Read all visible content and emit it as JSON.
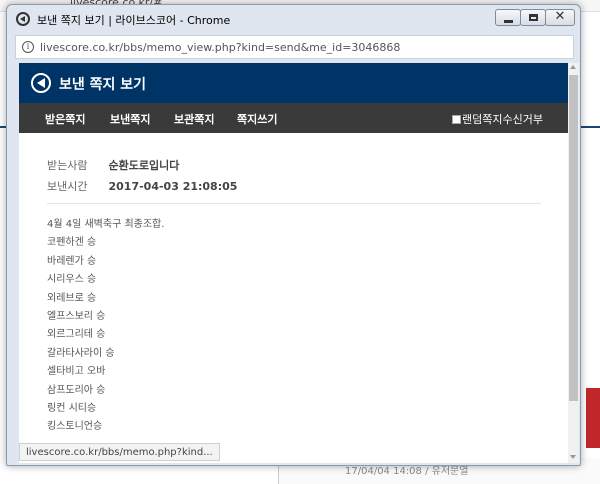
{
  "background": {
    "address": "livescore.co.kr/#",
    "bottom_text": "17/04/04 14:08 / 유저문열"
  },
  "window": {
    "title": "보낸 쪽지 보기 | 라이브스코어 - Chrome",
    "close_glyph": "✕"
  },
  "urlbar": {
    "info_glyph": "i",
    "url": "livescore.co.kr/bbs/memo_view.php?kind=send&me_id=3046868"
  },
  "header": {
    "title": "보낸 쪽지 보기"
  },
  "nav": {
    "items": [
      "받은쪽지",
      "보낸쪽지",
      "보관쪽지",
      "쪽지쓰기"
    ],
    "reject_label": "랜덤쪽지수신거부"
  },
  "meta": {
    "recipient_label": "받는사람",
    "recipient_value": "순환도로입니다",
    "sent_label": "보낸시간",
    "sent_value": "2017-04-03 21:08:05"
  },
  "message": {
    "lines": [
      "4월 4일 새벽축구 최종조합.",
      "코펜하겐 승",
      "바레렌가 승",
      "시리우스 승",
      "외레브로 승",
      "엘프스보리 승",
      "외르그리테 승",
      "갈라타사라이 승",
      "셀타비고 오바",
      "삼프도리아 승",
      "링컨 시티승",
      "킹스토니언승"
    ]
  },
  "status": {
    "text": "livescore.co.kr/bbs/memo.php?kind..."
  },
  "colors": {
    "header_bg": "#003366",
    "nav_bg": "#3a3a3a"
  }
}
